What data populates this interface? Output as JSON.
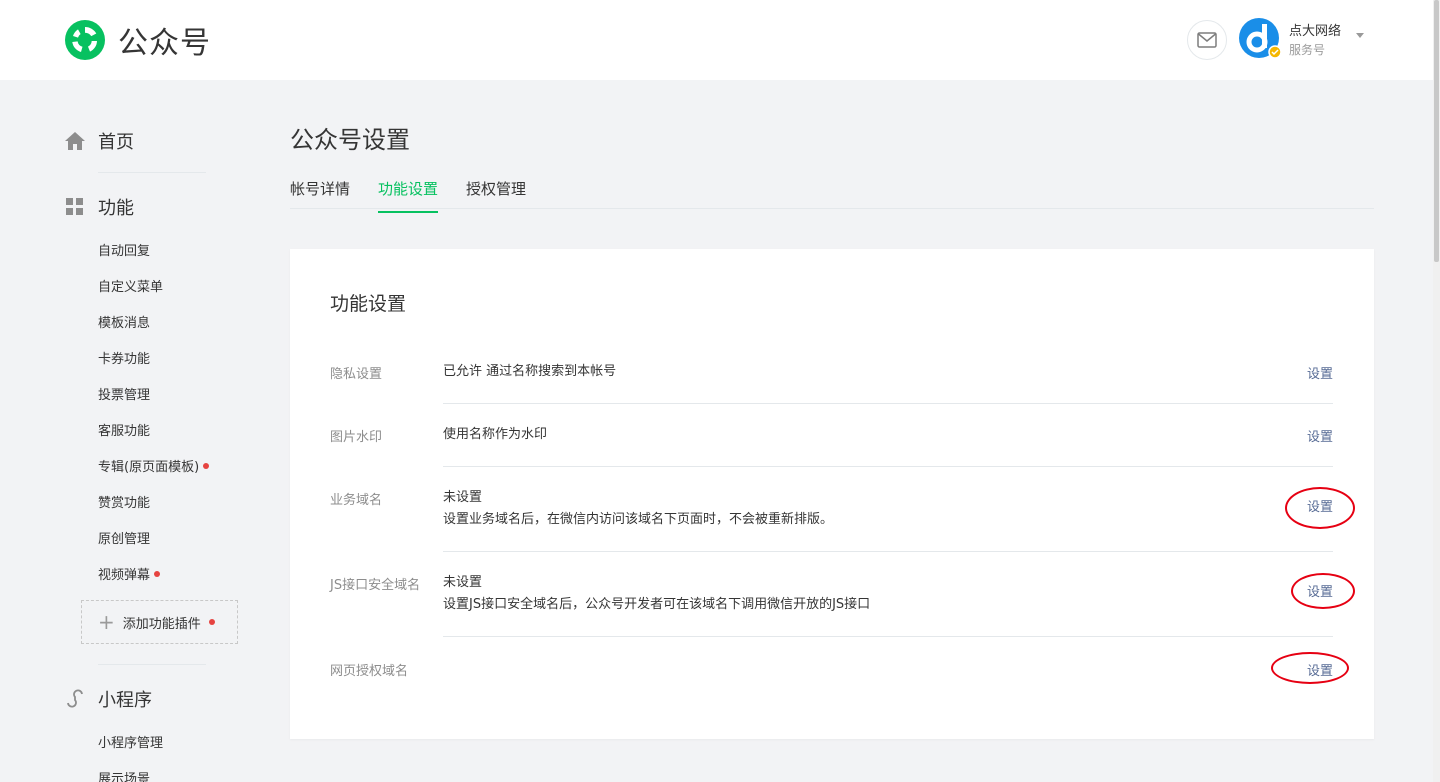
{
  "header": {
    "brand": "公众号",
    "account_name": "点大网络",
    "account_type": "服务号",
    "mail_icon": "mail-icon",
    "brand_color": "#07c160"
  },
  "sidebar": {
    "home": "首页",
    "function": "功能",
    "function_items": [
      {
        "label": "自动回复",
        "dot": false
      },
      {
        "label": "自定义菜单",
        "dot": false
      },
      {
        "label": "模板消息",
        "dot": false
      },
      {
        "label": "卡券功能",
        "dot": false
      },
      {
        "label": "投票管理",
        "dot": false
      },
      {
        "label": "客服功能",
        "dot": false
      },
      {
        "label": "专辑(原页面模板)",
        "dot": true
      },
      {
        "label": "赞赏功能",
        "dot": false
      },
      {
        "label": "原创管理",
        "dot": false
      },
      {
        "label": "视频弹幕",
        "dot": true
      }
    ],
    "add_plugin": "添加功能插件",
    "mini_program": "小程序",
    "mini_items": [
      {
        "label": "小程序管理"
      },
      {
        "label": "展示场景"
      }
    ]
  },
  "main": {
    "page_title": "公众号设置",
    "tabs": [
      {
        "label": "帐号详情",
        "active": false
      },
      {
        "label": "功能设置",
        "active": true
      },
      {
        "label": "授权管理",
        "active": false
      }
    ],
    "card_title": "功能设置",
    "rows": [
      {
        "label": "隐私设置",
        "value": "已允许 通过名称搜索到本帐号",
        "desc": "",
        "action": "设置",
        "highlighted": false
      },
      {
        "label": "图片水印",
        "value": "使用名称作为水印",
        "desc": "",
        "action": "设置",
        "highlighted": false
      },
      {
        "label": "业务域名",
        "value": "未设置",
        "desc": "设置业务域名后，在微信内访问该域名下页面时，不会被重新排版。",
        "action": "设置",
        "highlighted": true
      },
      {
        "label": "JS接口安全域名",
        "value": "未设置",
        "desc": "设置JS接口安全域名后，公众号开发者可在该域名下调用微信开放的JS接口",
        "action": "设置",
        "highlighted": true
      },
      {
        "label": "网页授权域名",
        "value": "",
        "desc": "",
        "action": "设置",
        "highlighted": true
      }
    ]
  }
}
